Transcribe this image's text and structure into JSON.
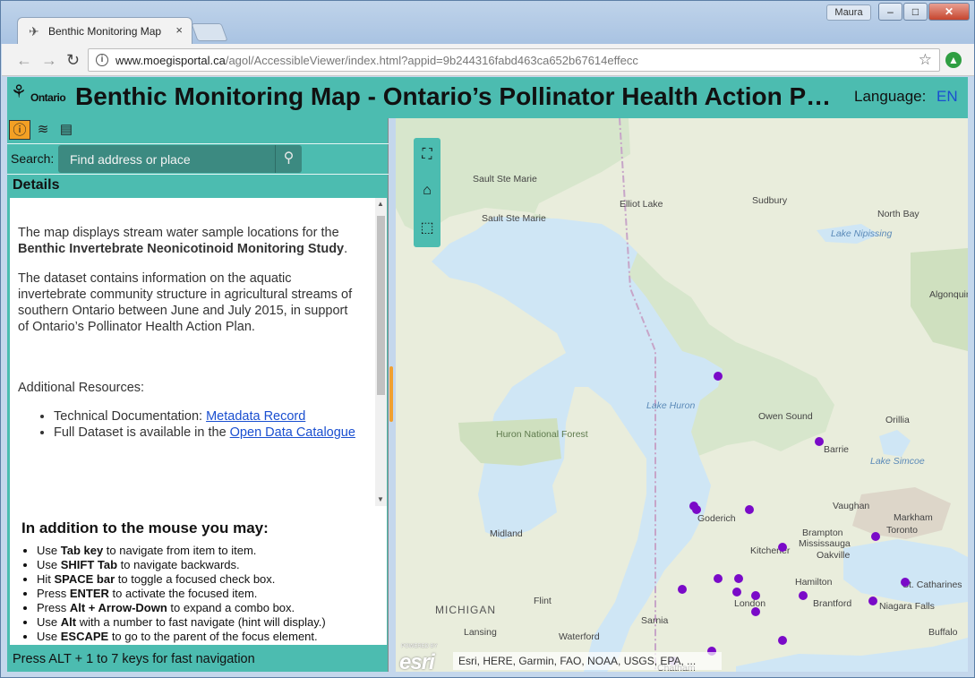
{
  "browser": {
    "tab_title": "Benthic Monitoring Map",
    "tab_close": "×",
    "user_name": "Maura",
    "window_controls": {
      "minimize": "–",
      "maximize": "□",
      "close": "✕"
    },
    "nav": {
      "back": "←",
      "forward": "→",
      "reload": "↻"
    },
    "url_host": "www.moegisportal.ca",
    "url_path": "/agol/AccessibleViewer/index.html?appid=9b244316fabd463ca652b67614effecc",
    "bookmark_icon": "star-icon",
    "extension_icon": "extension-icon"
  },
  "header": {
    "logo_text": "Ontario",
    "title": "Benthic Monitoring Map - Ontario’s Pollinator Health Action Plan",
    "language_label": "Language:",
    "language_value": "EN"
  },
  "panel": {
    "tools": [
      "details-icon",
      "layers-icon",
      "legend-icon"
    ],
    "search_label": "Search:",
    "search_placeholder": "Find address or place",
    "details_heading": "Details",
    "details": {
      "p1_prefix": "The map displays stream water sample locations for the ",
      "p1_bold": "Benthic Invertebrate Neonicotinoid Monitoring Study",
      "p1_suffix": ".",
      "p2": "The dataset contains information on the aquatic invertebrate community structure in agricultural streams of southern Ontario between June and July 2015, in support of Ontario’s Pollinator Health Action Plan.",
      "resources_label": "Additional Resources:",
      "res1_prefix": "Technical Documentation: ",
      "res1_link": "Metadata Record",
      "res2_prefix": "Full Dataset is available in the ",
      "res2_link": "Open Data Catalogue"
    },
    "help": {
      "heading": "In addition to the mouse you may:",
      "items": [
        {
          "pre": "Use ",
          "key": "Tab key",
          "post": " to navigate from item to item."
        },
        {
          "pre": "Use ",
          "key": "SHIFT Tab",
          "post": " to navigate backwards."
        },
        {
          "pre": "Hit ",
          "key": "SPACE bar",
          "post": " to toggle a focused check box."
        },
        {
          "pre": "Press ",
          "key": "ENTER",
          "post": " to activate the focused item."
        },
        {
          "pre": "Press ",
          "key": "Alt + Arrow-Down",
          "post": " to expand a combo box."
        },
        {
          "pre": "Use ",
          "key": "Alt",
          "post": " with a number to fast navigate (hint will display.)"
        },
        {
          "pre": "Use ",
          "key": "ESCAPE",
          "post": " to go to the parent of the focus element."
        }
      ]
    },
    "footer": "Press ALT + 1 to 7 keys for fast navigation"
  },
  "map": {
    "tools": [
      "fullscreen-icon",
      "home-icon",
      "extent-icon"
    ],
    "colors": {
      "water": "#cfe6f5",
      "land": "#e9eddc",
      "forest": "#d4e6c6",
      "urban": "#ddd6c9",
      "point": "#7a0ac8",
      "accent": "#4cbcb0"
    },
    "labels": [
      "Sault Ste Marie",
      "Sault Ste Marie",
      "Elliot Lake",
      "Sudbury",
      "North Bay",
      "Lake Nipissing",
      "Algonquin Provincial Park",
      "Lake Huron",
      "Huron National Forest",
      "Owen Sound",
      "Orillia",
      "Barrie",
      "Lake Simcoe",
      "Vaughan",
      "Markham",
      "Toronto",
      "Brampton",
      "Mississauga",
      "Oakville",
      "Goderich",
      "Kitchener",
      "Hamilton",
      "St. Catharines",
      "Brantford",
      "London",
      "Niagara Falls",
      "Buffalo",
      "Midland",
      "MICHIGAN",
      "Flint",
      "Sarnia",
      "Lansing",
      "Waterford",
      "Chatham"
    ],
    "powered_by": "POWERED BY",
    "esri_logo": "esri",
    "attribution": "Esri, HERE, Garmin, FAO, NOAA, USGS, EPA, ..."
  }
}
